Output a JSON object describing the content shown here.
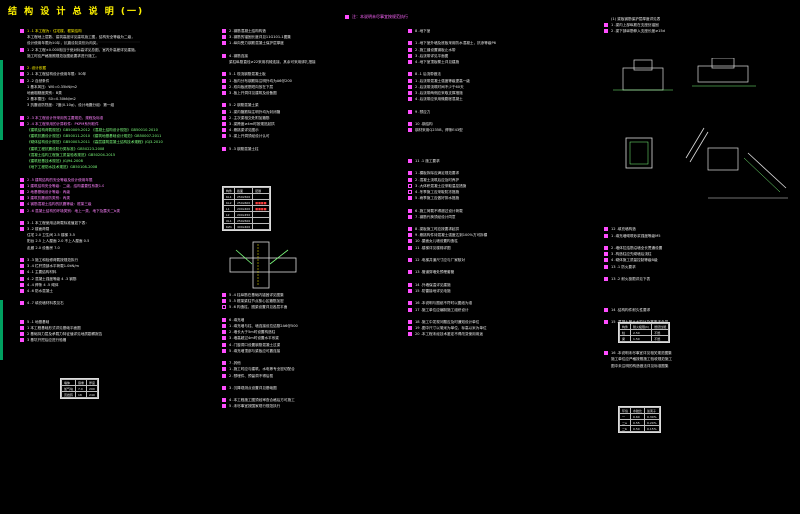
{
  "sheet_title": "结 构 设 计 总 说 明 (一)",
  "top_note": "注：本说明未尽事宜按规范执行",
  "col1": [
    {
      "cb": "on",
      "t": "1 .1 本工程为：住宅楼，框架结构",
      "c": "y"
    },
    {
      "cb": "",
      "t": "本工程地上层数、建筑高度详见建筑施工图，结构安全等级为二级，",
      "c": "w"
    },
    {
      "cb": "",
      "t": "设计使用年限为50年，抗震设防类别为丙类。",
      "c": "w"
    },
    {
      "cb": "on",
      "t": "1 .2 本工程±0.000相当于绝对标高详见总图，室内外高差详见建施。",
      "c": "w"
    },
    {
      "cb": "",
      "t": "施工时应严格按照规范及图纸要求进行施工。",
      "c": "w"
    },
    {
      "cb": "",
      "t": "",
      "c": "w"
    },
    {
      "cb": "on",
      "t": "2 .设计依据",
      "c": "y"
    },
    {
      "cb": "on",
      "t": "2 .1 本工程结构设计使用年限：50年",
      "c": "w"
    },
    {
      "cb": "on",
      "t": "2 .2 自然条件",
      "c": "w"
    },
    {
      "cb": "",
      "t": "1 基本风压：W0=0.35kN/m2",
      "c": "w"
    },
    {
      "cb": "",
      "t": "地面粗糙度类别：B类",
      "c": "w"
    },
    {
      "cb": "",
      "t": "2 基本雪压：S0=0.30kN/m2",
      "c": "w"
    },
    {
      "cb": "",
      "t": "3 抗震设防烈度：7度(0.10g)，设计地震分组：第一组",
      "c": "w"
    },
    {
      "cb": "",
      "t": "",
      "c": "w"
    },
    {
      "cb": "on",
      "t": "2 .3 本工程设计所采用的主要规范、规程及标准",
      "c": "m"
    },
    {
      "cb": "on",
      "t": "2 .4 本工程采用的计算软件：PKPM系列软件",
      "c": "m"
    },
    {
      "cb": "",
      "t": "《建筑结构荷载规范》GB50009-2012    《混凝土结构设计规范》GB50010-2010",
      "c": "g"
    },
    {
      "cb": "",
      "t": "《建筑抗震设计规范》GB50011-2010    《建筑地基基础设计规范》GB50007-2011",
      "c": "g"
    },
    {
      "cb": "",
      "t": "《砌体结构设计规范》GB50003-2011    《高层建筑混凝土结构技术规程》JGJ3-2010",
      "c": "g"
    },
    {
      "cb": "",
      "t": "《建筑工程抗震设防分类标准》GB50223-2008",
      "c": "g"
    },
    {
      "cb": "",
      "t": "《混凝土结构工程施工质量验收规范》GB50204-2015",
      "c": "g"
    },
    {
      "cb": "",
      "t": "《建筑桩基技术规范》JGJ94-2008",
      "c": "g"
    },
    {
      "cb": "",
      "t": "《地下工程防水技术规范》GB50108-2008",
      "c": "g"
    },
    {
      "cb": "",
      "t": "",
      "c": "w"
    },
    {
      "cb": "on",
      "t": "2 .5 建筑结构的安全等级及设计使用年限",
      "c": "m"
    },
    {
      "cb": "on",
      "t": "1 建筑结构安全等级：二级，结构重要性系数1.0",
      "c": "m"
    },
    {
      "cb": "on",
      "t": "2 地基基础设计等级：丙级",
      "c": "m"
    },
    {
      "cb": "on",
      "t": "3 建筑抗震设防类别：丙类",
      "c": "m"
    },
    {
      "cb": "on",
      "t": "4 钢筋混凝土结构的抗震等级：框架三级",
      "c": "m"
    },
    {
      "cb": "on",
      "t": "2 .6 混凝土结构的环境类别：地上一类，地下及露天二b类",
      "c": "m"
    },
    {
      "cb": "",
      "t": "",
      "c": "w"
    },
    {
      "cb": "on",
      "t": "3 .1 本工程使用活荷载标准值如下表：",
      "c": "w"
    },
    {
      "cb": "on",
      "t": "3 .2 楼面荷载",
      "c": "w"
    },
    {
      "cb": "",
      "t": "住宅  2.0   卫生间 2.5   楼梯 3.5",
      "c": "w"
    },
    {
      "cb": "",
      "t": "阳台  2.5   上人屋面 2.0   不上人屋面 0.5",
      "c": "w"
    },
    {
      "cb": "",
      "t": "走廊  2.0   设备房 7.0",
      "c": "w"
    },
    {
      "cb": "",
      "t": "",
      "c": "w"
    },
    {
      "cb": "on",
      "t": "3 .3 施工和检修荷载按规范执行",
      "c": "w"
    },
    {
      "cb": "on",
      "t": "3 .4 栏杆顶部水平荷载1.0kN/m",
      "c": "w"
    },
    {
      "cb": "on",
      "t": "4 .1 主要结构材料",
      "c": "w"
    },
    {
      "cb": "on",
      "t": "4 .2 混凝土强度等级     4 .3 钢筋",
      "c": "w"
    },
    {
      "cb": "on",
      "t": "4 .4 焊条     4 .5 砌体",
      "c": "w"
    },
    {
      "cb": "on",
      "t": "4 .6 防水混凝土",
      "c": "w"
    },
    {
      "cb": "",
      "t": "",
      "c": "w"
    },
    {
      "cb": "on",
      "t": "4 .7 填充墙材料表见右",
      "c": "w"
    },
    {
      "cb": "",
      "t": "",
      "c": "w"
    },
    {
      "cb": "",
      "t": "",
      "c": "w"
    },
    {
      "cb": "on",
      "t": "5 .1 地基基础",
      "c": "w"
    },
    {
      "cb": "on",
      "t": "1 本工程基础形式详见基础平面图",
      "c": "w"
    },
    {
      "cb": "on",
      "t": "2 基础持力层及承载力特征值详见地质勘察报告",
      "c": "w"
    },
    {
      "cb": "on",
      "t": "3 基坑开挖后应进行验槽",
      "c": "w"
    }
  ],
  "col2": [
    {
      "cb": "on",
      "t": "2 .钢筋混凝土结构构造",
      "c": "w"
    },
    {
      "cb": "on",
      "t": "3 .钢筋的锚固长度详见11G101-1图集",
      "c": "w"
    },
    {
      "cb": "on",
      "t": "1 .纵向受力钢筋混凝土保护层厚度",
      "c": "w"
    },
    {
      "cb": "",
      "t": "",
      "c": "w"
    },
    {
      "cb": "on",
      "t": "4 .钢筋连接",
      "c": "w"
    },
    {
      "cb": "",
      "t": "梁柱纵筋直径≥22采用机械连接，其余可采用绑扎搭接",
      "c": "w"
    },
    {
      "cb": "",
      "t": "",
      "c": "w"
    },
    {
      "cb": "on",
      "t": "5 .1 现浇钢筋混凝土板",
      "c": "w"
    },
    {
      "cb": "on",
      "t": "1 .板内分布钢筋除注明外均为A6@200",
      "c": "w"
    },
    {
      "cb": "on",
      "t": "2 .双向板底筋短向放在下层",
      "c": "w"
    },
    {
      "cb": "on",
      "t": "3 .板上开洞详见建筑及设备图",
      "c": "w"
    },
    {
      "cb": "",
      "t": "",
      "c": "w"
    },
    {
      "cb": "on",
      "t": "5 .2 钢筋混凝土梁",
      "c": "w"
    },
    {
      "cb": "on",
      "t": "1 .梁内箍筋除注明外均为封闭箍",
      "c": "w"
    },
    {
      "cb": "on",
      "t": "2 .主次梁相交处附加箍筋",
      "c": "w"
    },
    {
      "cb": "on",
      "t": "3 .梁跨度≥4m时按规范起拱",
      "c": "w"
    },
    {
      "cb": "on",
      "t": "4 .悬挑梁详见图示",
      "c": "w"
    },
    {
      "cb": "on",
      "t": "5 .梁上开洞须经设计认可",
      "c": "w"
    },
    {
      "cb": "",
      "t": "",
      "c": "w"
    },
    {
      "cb": "on",
      "t": "5 .3 钢筋混凝土柱",
      "c": "w"
    },
    {
      "cb": "",
      "t": "",
      "c": "w"
    },
    {
      "cb": "",
      "t": "",
      "c": "w"
    },
    {
      "cb": "",
      "t": "",
      "c": "w"
    },
    {
      "cb": "",
      "t": "",
      "c": "w"
    },
    {
      "cb": "",
      "t": "",
      "c": "w"
    },
    {
      "cb": "",
      "t": "",
      "c": "w"
    },
    {
      "cb": "",
      "t": "",
      "c": "w"
    },
    {
      "cb": "",
      "t": "",
      "c": "w"
    },
    {
      "cb": "",
      "t": "",
      "c": "w"
    },
    {
      "cb": "",
      "t": "",
      "c": "w"
    },
    {
      "cb": "",
      "t": "",
      "c": "w"
    },
    {
      "cb": "",
      "t": "",
      "c": "w"
    },
    {
      "cb": "",
      "t": "",
      "c": "w"
    },
    {
      "cb": "",
      "t": "",
      "c": "w"
    },
    {
      "cb": "",
      "t": "",
      "c": "w"
    },
    {
      "cb": "",
      "t": "",
      "c": "w"
    },
    {
      "cb": "",
      "t": "",
      "c": "w"
    },
    {
      "cb": "",
      "t": "",
      "c": "w"
    },
    {
      "cb": "",
      "t": "",
      "c": "w"
    },
    {
      "cb": "",
      "t": "",
      "c": "w"
    },
    {
      "cb": "",
      "t": "",
      "c": "w"
    },
    {
      "cb": "",
      "t": "",
      "c": "w"
    },
    {
      "cb": "",
      "t": "",
      "c": "w"
    },
    {
      "cb": "",
      "t": "",
      "c": "w"
    },
    {
      "cb": "",
      "t": "",
      "c": "w"
    },
    {
      "cb": "",
      "t": "",
      "c": "w"
    },
    {
      "cb": "",
      "t": "",
      "c": "w"
    },
    {
      "cb": "",
      "t": "",
      "c": "w"
    }
  ],
  "col2b": [
    {
      "cb": "on",
      "t": "5 .4 柱纵筋在基础内锚固详见图集",
      "c": "w"
    },
    {
      "cb": "on",
      "t": "5 .5 框架梁柱节点核心区箍筋加密",
      "c": "w"
    },
    {
      "cb": "off",
      "t": "5 .6 构造柱、圈梁设置详见各层平面",
      "c": "w"
    },
    {
      "cb": "",
      "t": "",
      "c": "w"
    },
    {
      "cb": "on",
      "t": "6 .填充墙",
      "c": "w"
    },
    {
      "cb": "on",
      "t": "1 .填充墙与柱、墙连接设拉结筋2A6@500",
      "c": "w"
    },
    {
      "cb": "on",
      "t": "2 .墙长大于5m时设置构造柱",
      "c": "w"
    },
    {
      "cb": "on",
      "t": "3 .墙高超过4m时设置水平系梁",
      "c": "w"
    },
    {
      "cb": "on",
      "t": "4 .门窗洞口设置钢筋混凝土过梁",
      "c": "w"
    },
    {
      "cb": "on",
      "t": "5 .填充墙顶部与梁板应可靠连接",
      "c": "w"
    },
    {
      "cb": "",
      "t": "",
      "c": "w"
    },
    {
      "cb": "on",
      "t": "7 .其他",
      "c": "w"
    },
    {
      "cb": "on",
      "t": "1 .施工时应与建筑、水电等专业密切配合",
      "c": "w"
    },
    {
      "cb": "on",
      "t": "2 .预埋件、预留洞不得后凿",
      "c": "w"
    },
    {
      "cb": "",
      "t": "",
      "c": "w"
    },
    {
      "cb": "on",
      "t": "3 .沉降观测点设置详见基础图",
      "c": "w"
    },
    {
      "cb": "",
      "t": "",
      "c": "w"
    },
    {
      "cb": "on",
      "t": "4 .本工程施工图须经审查合格后方可施工",
      "c": "w"
    },
    {
      "cb": "on",
      "t": "5 .未尽事宜按国家现行规范执行",
      "c": "w"
    }
  ],
  "col3": [
    {
      "cb": "on",
      "t": "8 .地下室",
      "c": "w"
    },
    {
      "cb": "",
      "t": "",
      "c": "w"
    },
    {
      "cb": "on",
      "t": "1 .地下室外墙及底板采用防水混凝土，抗渗等级P6",
      "c": "w"
    },
    {
      "cb": "on",
      "t": "2 .施工缝设置钢板止水带",
      "c": "w"
    },
    {
      "cb": "on",
      "t": "3 .后浇带详见平面图",
      "c": "w"
    },
    {
      "cb": "on",
      "t": "4 .地下室顶板覆土详见建施",
      "c": "w"
    },
    {
      "cb": "",
      "t": "",
      "c": "w"
    },
    {
      "cb": "on",
      "t": "8 .1 后浇带做法",
      "c": "w"
    },
    {
      "cb": "on",
      "t": "1 .后浇带混凝土强度等级提高一级",
      "c": "w"
    },
    {
      "cb": "on",
      "t": "2 .后浇带浇筑时间不少于60天",
      "c": "w"
    },
    {
      "cb": "on",
      "t": "3 .后浇带两侧应采取支撑措施",
      "c": "w"
    },
    {
      "cb": "on",
      "t": "4 .后浇带应采用微膨胀混凝土",
      "c": "w"
    },
    {
      "cb": "",
      "t": "",
      "c": "w"
    },
    {
      "cb": "on",
      "t": "9 .预应力",
      "c": "w"
    },
    {
      "cb": "",
      "t": "",
      "c": "w"
    },
    {
      "cb": "on",
      "t": "10 .钢结构",
      "c": "w"
    },
    {
      "cb": "on",
      "t": "钢材采用Q235B，焊条E43型",
      "c": "w"
    },
    {
      "cb": "",
      "t": "",
      "c": "w"
    },
    {
      "cb": "",
      "t": "",
      "c": "w"
    },
    {
      "cb": "",
      "t": "",
      "c": "w"
    },
    {
      "cb": "",
      "t": "",
      "c": "w"
    },
    {
      "cb": "on",
      "t": "11 .1 施工要求",
      "c": "w"
    },
    {
      "cb": "",
      "t": "",
      "c": "w"
    },
    {
      "cb": "on",
      "t": "1 .模板拆除应满足规范要求",
      "c": "w"
    },
    {
      "cb": "on",
      "t": "2 .混凝土浇筑后应及时养护",
      "c": "w"
    },
    {
      "cb": "off",
      "t": "3 .大体积混凝土应采取温控措施",
      "c": "w"
    },
    {
      "cb": "off",
      "t": "4 .冬季施工应采取防冻措施",
      "c": "w"
    },
    {
      "cb": "on",
      "t": "5 .雨季施工应做好排水措施",
      "c": "w"
    },
    {
      "cb": "",
      "t": "",
      "c": "w"
    },
    {
      "cb": "on",
      "t": "6 .施工荷载不得超过设计荷载",
      "c": "w"
    },
    {
      "cb": "on",
      "t": "7 .钢筋代换须经设计同意",
      "c": "w"
    },
    {
      "cb": "",
      "t": "",
      "c": "w"
    },
    {
      "cb": "on",
      "t": "8 .梁板施工时应按要求起拱",
      "c": "w"
    },
    {
      "cb": "on",
      "t": "9 .悬挑构件待混凝土强度达到100%方可拆模",
      "c": "w"
    },
    {
      "cb": "on",
      "t": "10 .屋面女儿墙设置构造柱",
      "c": "w"
    },
    {
      "cb": "on",
      "t": "11 .楼梯详见楼梯详图",
      "c": "w"
    },
    {
      "cb": "",
      "t": "",
      "c": "w"
    },
    {
      "cb": "on",
      "t": "12 .电梯井道尺寸应与厂家核对",
      "c": "w"
    },
    {
      "cb": "",
      "t": "",
      "c": "w"
    },
    {
      "cb": "on",
      "t": "13 .管道穿墙处预埋套管",
      "c": "w"
    },
    {
      "cb": "",
      "t": "",
      "c": "w"
    },
    {
      "cb": "on",
      "t": "14 .外墙保温详见建施",
      "c": "w"
    },
    {
      "cb": "on",
      "t": "15 .防雷接地详见电施",
      "c": "w"
    },
    {
      "cb": "",
      "t": "",
      "c": "w"
    },
    {
      "cb": "on",
      "t": "16 .本说明与图纸不符时以图纸为准",
      "c": "w"
    },
    {
      "cb": "on",
      "t": "17 .施工单位应编制施工组织设计",
      "c": "w"
    },
    {
      "cb": "",
      "t": "",
      "c": "w"
    },
    {
      "cb": "on",
      "t": "18 .施工中发现问题应及时通知设计单位",
      "c": "w"
    },
    {
      "cb": "on",
      "t": "19 .图中尺寸以毫米为单位，标高以米为单位",
      "c": "w"
    },
    {
      "cb": "on",
      "t": "20 .本工程未经技术鉴定不得改变使用用途",
      "c": "w"
    }
  ],
  "col4": [
    {
      "cb": "",
      "t": "(1) 梁板钢筋保护层厚度详见表",
      "c": "w"
    },
    {
      "cb": "on",
      "t": "1 .梁内上部纵筋在支座处锚固",
      "c": "w"
    },
    {
      "cb": "on",
      "t": "2 .梁下部纵筋伸入支座长度≥15d",
      "c": "w"
    },
    {
      "cb": "",
      "t": "",
      "c": "w"
    },
    {
      "cb": "",
      "t": "",
      "c": "w"
    },
    {
      "cb": "",
      "t": "",
      "c": "w"
    },
    {
      "cb": "",
      "t": "",
      "c": "w"
    },
    {
      "cb": "",
      "t": "",
      "c": "w"
    },
    {
      "cb": "",
      "t": "",
      "c": "w"
    },
    {
      "cb": "",
      "t": "",
      "c": "w"
    },
    {
      "cb": "",
      "t": "",
      "c": "w"
    },
    {
      "cb": "",
      "t": "",
      "c": "w"
    },
    {
      "cb": "",
      "t": "",
      "c": "w"
    },
    {
      "cb": "",
      "t": "",
      "c": "w"
    },
    {
      "cb": "",
      "t": "",
      "c": "w"
    },
    {
      "cb": "",
      "t": "",
      "c": "w"
    },
    {
      "cb": "",
      "t": "",
      "c": "w"
    },
    {
      "cb": "",
      "t": "",
      "c": "w"
    },
    {
      "cb": "",
      "t": "",
      "c": "w"
    },
    {
      "cb": "",
      "t": "",
      "c": "w"
    },
    {
      "cb": "",
      "t": "",
      "c": "w"
    },
    {
      "cb": "",
      "t": "",
      "c": "w"
    },
    {
      "cb": "",
      "t": "",
      "c": "w"
    },
    {
      "cb": "",
      "t": "",
      "c": "w"
    },
    {
      "cb": "",
      "t": "",
      "c": "w"
    },
    {
      "cb": "",
      "t": "",
      "c": "w"
    },
    {
      "cb": "",
      "t": "",
      "c": "w"
    },
    {
      "cb": "",
      "t": "",
      "c": "w"
    },
    {
      "cb": "",
      "t": "",
      "c": "w"
    },
    {
      "cb": "",
      "t": "",
      "c": "w"
    },
    {
      "cb": "",
      "t": "",
      "c": "w"
    },
    {
      "cb": "",
      "t": "",
      "c": "w"
    },
    {
      "cb": "",
      "t": "",
      "c": "w"
    },
    {
      "cb": "",
      "t": "",
      "c": "w"
    },
    {
      "cb": "on",
      "t": "12 .填充墙构造",
      "c": "w"
    },
    {
      "cb": "on",
      "t": "1 .填充墙砌筑砂浆强度等级M5",
      "c": "w"
    },
    {
      "cb": "",
      "t": "",
      "c": "w"
    },
    {
      "cb": "on",
      "t": "2 .墙体拉结筋沿墙全长贯通设置",
      "c": "w"
    },
    {
      "cb": "on",
      "t": "3 .构造柱应先砌墙后浇柱",
      "c": "w"
    },
    {
      "cb": "on",
      "t": "4 .砌体施工质量控制等级B级",
      "c": "w"
    },
    {
      "cb": "on",
      "t": "13 .1 防火要求",
      "c": "w"
    },
    {
      "cb": "",
      "t": "",
      "c": "w"
    },
    {
      "cb": "on",
      "t": "13 .2 耐火极限详见下表",
      "c": "w"
    },
    {
      "cb": "",
      "t": "",
      "c": "w"
    },
    {
      "cb": "",
      "t": "",
      "c": "w"
    },
    {
      "cb": "",
      "t": "",
      "c": "w"
    },
    {
      "cb": "",
      "t": "",
      "c": "w"
    },
    {
      "cb": "on",
      "t": "14 .结构构件耐久性要求",
      "c": "w"
    },
    {
      "cb": "",
      "t": "",
      "c": "w"
    },
    {
      "cb": "on",
      "t": "15 .混凝土最大水胶比及氯离子含量",
      "c": "w"
    },
    {
      "cb": "",
      "t": "",
      "c": "w"
    },
    {
      "cb": "",
      "t": "",
      "c": "w"
    },
    {
      "cb": "",
      "t": "",
      "c": "w"
    },
    {
      "cb": "",
      "t": "",
      "c": "w"
    },
    {
      "cb": "on",
      "t": "16 .本说明未尽事宜详见相关规范图集",
      "c": "w"
    },
    {
      "cb": "",
      "t": "施工单位应严格按照施工验收规范施工",
      "c": "w"
    },
    {
      "cb": "",
      "t": "图中未注明的构造做法详见标准图集",
      "c": "w"
    }
  ],
  "load_table": {
    "header": [
      "构件",
      "截面",
      "配筋"
    ],
    "rows": [
      [
        "KL1",
        "250x500",
        ""
      ],
      [
        "KL2",
        "250x600",
        "r"
      ],
      [
        "L1",
        "200x400",
        "r"
      ],
      [
        "L2",
        "200x450",
        ""
      ],
      [
        "XL1",
        "250x500",
        ""
      ],
      [
        "KZ1",
        "400x400",
        ""
      ]
    ]
  },
  "small_table1": {
    "header": [
      "墙体",
      "容重",
      "厚度"
    ],
    "rows": [
      [
        "加气块",
        "7.0",
        "200"
      ],
      [
        "页岩砖",
        "18",
        "240"
      ]
    ]
  },
  "small_table2": {
    "header": [
      "构件",
      "耐火极限(h)",
      "燃烧性能"
    ],
    "rows": [
      [
        "柱",
        "2.50",
        "不燃"
      ],
      [
        "梁",
        "1.50",
        "不燃"
      ]
    ]
  },
  "small_table3": {
    "header": [
      "环境",
      "水胶比",
      "氯离子"
    ],
    "rows": [
      [
        "一",
        "0.60",
        "0.30%"
      ],
      [
        "二a",
        "0.55",
        "0.20%"
      ],
      [
        "二b",
        "0.50",
        "0.15%"
      ]
    ]
  }
}
